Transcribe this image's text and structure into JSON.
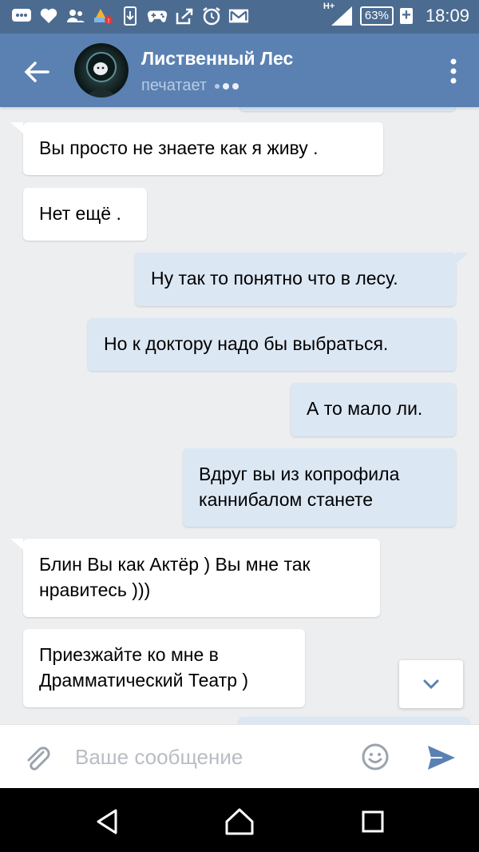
{
  "status_bar": {
    "battery": "63%",
    "time": "18:09",
    "network": "H+",
    "icons": [
      "messages-icon",
      "heart-icon",
      "contacts-icon",
      "weather-alert-icon",
      "phone-screen-icon",
      "gamepad-icon",
      "share-icon",
      "alarm-icon",
      "mail-icon"
    ]
  },
  "header": {
    "title": "Лиственный Лес",
    "status": "печатает"
  },
  "messages": [
    {
      "dir": "in",
      "text": "Вы просто не знаете как я живу ."
    },
    {
      "dir": "in",
      "text": "Нет ещё ."
    },
    {
      "dir": "out",
      "text": "Ну так то понятно что в лесу."
    },
    {
      "dir": "out",
      "text": "Но к доктору надо бы выбраться."
    },
    {
      "dir": "out",
      "text": "А то мало ли."
    },
    {
      "dir": "out",
      "text": "Вдруг вы из копрофила каннибалом станете"
    },
    {
      "dir": "in",
      "text": "Блин Вы как Актёр ) Вы мне так нравитесь )))"
    },
    {
      "dir": "in",
      "text": "Приезжайте ко мне в Драмматический Театр )"
    }
  ],
  "composer": {
    "placeholder": "Ваше сообщение"
  },
  "colors": {
    "header": "#5b81b2",
    "status_bar": "#4c6b91",
    "chat_background": "#edeef0",
    "incoming_bubble": "#ffffff",
    "outgoing_bubble": "#dce7f4",
    "accent": "#5b81b2"
  }
}
